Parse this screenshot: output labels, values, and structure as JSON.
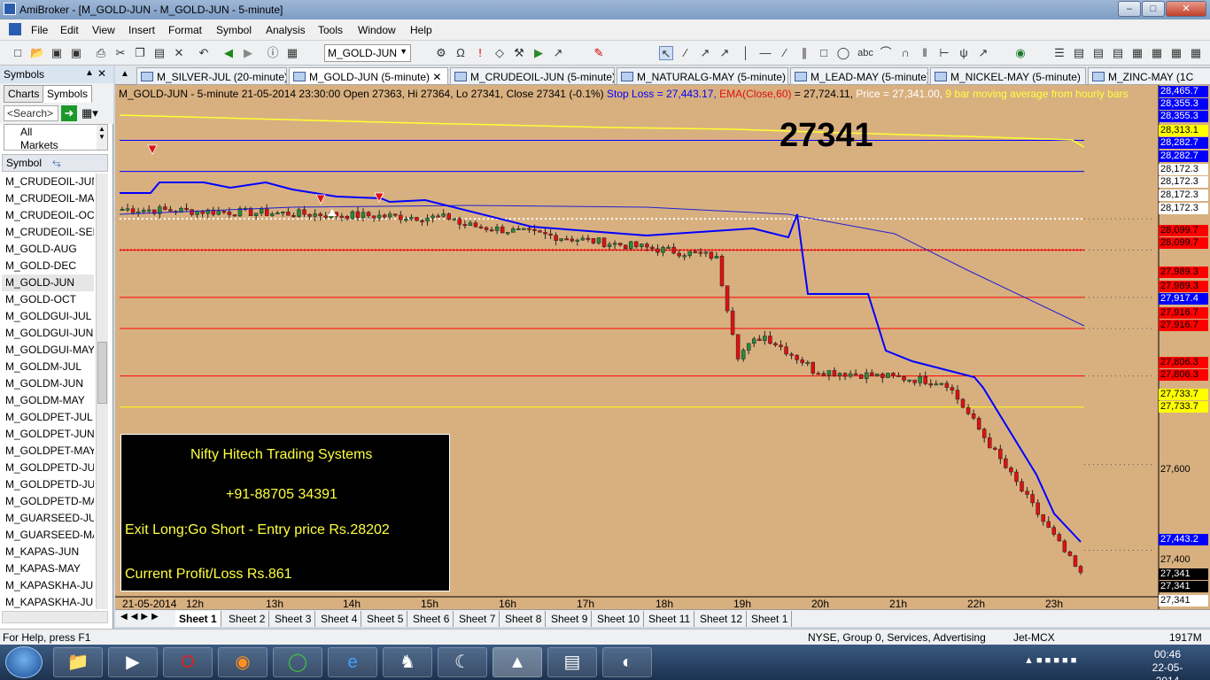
{
  "window": {
    "title": "AmiBroker - [M_GOLD-JUN - M_GOLD-JUN - 5-minute]"
  },
  "menu": [
    "File",
    "Edit",
    "View",
    "Insert",
    "Format",
    "Symbol",
    "Analysis",
    "Tools",
    "Window",
    "Help"
  ],
  "toolbar": {
    "symbol": "M_GOLD-JUN"
  },
  "leftpanel": {
    "title": "Symbols",
    "tabs": [
      "Charts",
      "Symbols"
    ],
    "search_placeholder": "<Search>",
    "categories": [
      "All",
      "Markets"
    ],
    "column_header": "Symbol",
    "selected": "M_GOLD-JUN",
    "symbols": [
      "M_CRUDEOIL-JUN",
      "M_CRUDEOIL-MAY",
      "M_CRUDEOIL-OCT",
      "M_CRUDEOIL-SEP",
      "M_GOLD-AUG",
      "M_GOLD-DEC",
      "M_GOLD-JUN",
      "M_GOLD-OCT",
      "M_GOLDGUI-JUL",
      "M_GOLDGUI-JUN",
      "M_GOLDGUI-MAY",
      "M_GOLDM-JUL",
      "M_GOLDM-JUN",
      "M_GOLDM-MAY",
      "M_GOLDPET-JUL",
      "M_GOLDPET-JUN",
      "M_GOLDPET-MAY",
      "M_GOLDPETD-JUL",
      "M_GOLDPETD-JUN",
      "M_GOLDPETD-MA",
      "M_GUARSEED-JUN",
      "M_GUARSEED-MAY",
      "M_KAPAS-JUN",
      "M_KAPAS-MAY",
      "M_KAPASKHA-JUL",
      "M_KAPASKHA-JUN"
    ]
  },
  "charttabs": [
    {
      "label": "M_SILVER-JUL (20-minute)",
      "active": false
    },
    {
      "label": "M_GOLD-JUN (5-minute)",
      "active": true
    },
    {
      "label": "M_CRUDEOIL-JUN (5-minute)",
      "active": false
    },
    {
      "label": "M_NATURALG-MAY (5-minute)",
      "active": false
    },
    {
      "label": "M_LEAD-MAY (5-minute)",
      "active": false
    },
    {
      "label": "M_NICKEL-MAY (5-minute)",
      "active": false
    },
    {
      "label": "M_ZINC-MAY (1C",
      "active": false
    }
  ],
  "chart": {
    "info_main": "M_GOLD-JUN - 5-minute 21-05-2014 23:30:00 Open 27363, Hi 27364, Lo 27341, Close 27341 (-0.1%)",
    "info_stop": "Stop Loss = 27,443.17,",
    "info_ema_label": "EMA(Close,60)",
    "info_ema_value": "= 27,724.11,",
    "info_price": "Price = 27,341.00,",
    "info_ma": "9 bar moving average from hourly bars",
    "big_price": "27341",
    "colors": {
      "bg": "#d8b080",
      "stop": "#0000ff",
      "ema": "#2020d0",
      "up": "#2a8a3a",
      "down": "#e01010"
    },
    "box": {
      "line1": "Nifty Hitech Trading Systems",
      "line2": "+91-88705 34391",
      "line3": "Exit Long:Go Short - Entry price Rs.28202",
      "line4": "Current Profit/Loss Rs.861"
    },
    "price_labels": [
      {
        "text": "28,465.7",
        "bg": "#0000ff",
        "fg": "#ffffff"
      },
      {
        "text": "28,355.3",
        "bg": "#0000ff",
        "fg": "#ffffff"
      },
      {
        "text": "28,355.3",
        "bg": "#0000ff",
        "fg": "#ffffff"
      },
      {
        "text": "28,313.1",
        "bg": "#ffff00",
        "fg": "#000000"
      },
      {
        "text": "28,282.7",
        "bg": "#0000ff",
        "fg": "#ffffff"
      },
      {
        "text": "28,282.7",
        "bg": "#0000ff",
        "fg": "#ffffff"
      },
      {
        "text": "28,172.3",
        "bg": "#ffffff",
        "fg": "#000000"
      },
      {
        "text": "28,172.3",
        "bg": "#ffffff",
        "fg": "#000000"
      },
      {
        "text": "28,172.3",
        "bg": "#ffffff",
        "fg": "#000000"
      },
      {
        "text": "28,172.3",
        "bg": "#ffffff",
        "fg": "#000000"
      },
      {
        "text": "28,099.7",
        "bg": "#ff0000",
        "fg": "#000000"
      },
      {
        "text": "28,099.7",
        "bg": "#ff0000",
        "fg": "#000000"
      },
      {
        "text": "27,989.3",
        "bg": "#ff0000",
        "fg": "#000000"
      },
      {
        "text": "27,989.3",
        "bg": "#ff0000",
        "fg": "#000000"
      },
      {
        "text": "27,917.4",
        "bg": "#0000ff",
        "fg": "#ffffff"
      },
      {
        "text": "27,916.7",
        "bg": "#ff0000",
        "fg": "#000000"
      },
      {
        "text": "27,916.7",
        "bg": "#ff0000",
        "fg": "#000000"
      },
      {
        "text": "27,806.3",
        "bg": "#ff0000",
        "fg": "#000000"
      },
      {
        "text": "27,806.3",
        "bg": "#ff0000",
        "fg": "#000000"
      },
      {
        "text": "27,733.7",
        "bg": "#ffff00",
        "fg": "#000000"
      },
      {
        "text": "27,733.7",
        "bg": "#ffff00",
        "fg": "#000000"
      },
      {
        "text": "27,600",
        "bg": "transparent",
        "fg": "#000000"
      },
      {
        "text": "27,443.2",
        "bg": "#0000ff",
        "fg": "#ffffff"
      },
      {
        "text": "27,400",
        "bg": "transparent",
        "fg": "#000000"
      },
      {
        "text": "27,341",
        "bg": "#000000",
        "fg": "#ffffff"
      },
      {
        "text": "27,341",
        "bg": "#000000",
        "fg": "#ffffff"
      },
      {
        "text": "27,341",
        "bg": "#ffffff",
        "fg": "#000000"
      }
    ],
    "x_labels": [
      "21-05-2014",
      "12h",
      "13h",
      "14h",
      "15h",
      "16h",
      "17h",
      "18h",
      "19h",
      "20h",
      "21h",
      "22h",
      "23h"
    ]
  },
  "chart_data": {
    "type": "candlestick",
    "ylim": [
      27300,
      28480
    ],
    "x_labels": [
      "21-05-2014",
      "12h",
      "13h",
      "14h",
      "15h",
      "16h",
      "17h",
      "18h",
      "19h",
      "20h",
      "21h",
      "22h",
      "23h"
    ],
    "horizontal_levels": [
      {
        "value": 28355.3,
        "color": "#0000ff"
      },
      {
        "value": 28282.7,
        "color": "#0000ff"
      },
      {
        "value": 28099.7,
        "color": "#ff0000"
      },
      {
        "value": 27989.3,
        "color": "#ff0000"
      },
      {
        "value": 27916.7,
        "color": "#ff0000"
      },
      {
        "value": 27806.3,
        "color": "#ff0000"
      },
      {
        "value": 27733.7,
        "color": "#ffff00"
      }
    ],
    "stop_loss_last": 27443.17,
    "ema60_last": 27724.11,
    "last_close": 27341
  },
  "sheets": [
    "Sheet 1",
    "Sheet 2",
    "Sheet 3",
    "Sheet 4",
    "Sheet 5",
    "Sheet 6",
    "Sheet 7",
    "Sheet 8",
    "Sheet 9",
    "Sheet 10",
    "Sheet 11",
    "Sheet 12",
    "Sheet 1"
  ],
  "status": {
    "help": "For Help, press F1",
    "info": "NYSE, Group 0, Services, Advertising",
    "feed": "Jet-MCX",
    "mem": "1917M"
  },
  "taskbar": {
    "time": "00:46",
    "date": "22-05-2014"
  }
}
